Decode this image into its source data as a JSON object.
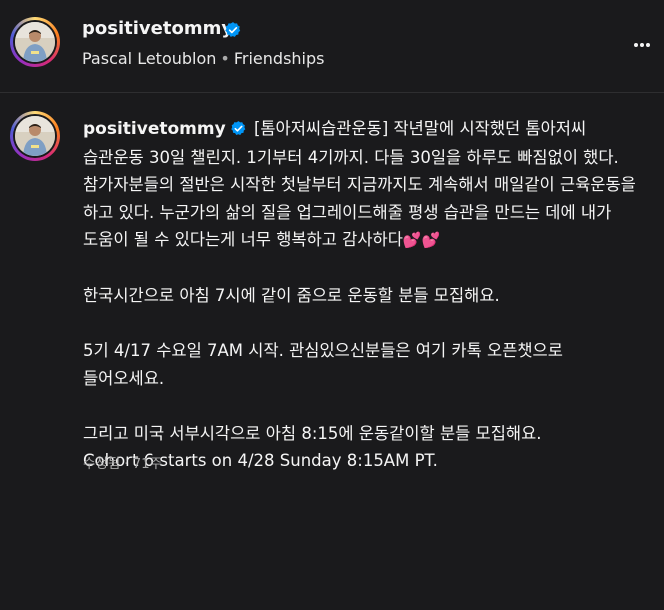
{
  "header": {
    "username": "positivetommy",
    "author_name": "Pascal Letoublon",
    "separator": "•",
    "audio_label": "Friendships"
  },
  "post": {
    "username": "positivetommy",
    "caption_line1": "[톰아저씨습관운동] 작년말에 시작했던 톰아저씨 습관운동 30일 챌린지. 1기부터 4기까지. 다들 30일을 하루도 빠짐없이 했다. 참가자분들의 절반은 시작한 첫날부터 지금까지도 계속해서 매일같이 근육운동을 하고 있다. 누군가의 삶의 질을 업그레이드해줄 평생 습관을 만드는 데에 내가 도움이 될 수 있다는게 너무 행복하고 감사하다",
    "hearts": "💕💕",
    "paragraph2": "한국시간으로 아침 7시에 같이 줌으로 운동할 분들 모집해요.",
    "paragraph3": "5기 4/17 수요일 7AM 시작. 관심있으신분들은 여기 카톡 오픈챗으로 들어오세요.",
    "paragraph4_line1": "그리고 미국 서부시각으로 아침 8:15에 운동같이할 분들 모집해요.",
    "paragraph4_line2": "Cohort 6 starts on 4/28 Sunday 8:15AM PT.",
    "edited_label": "수정됨",
    "meta_separator": "·",
    "age": "71주"
  },
  "icons": {
    "verified": "verified-badge-icon",
    "more": "more-options-icon"
  },
  "colors": {
    "background": "#1a1a1c",
    "verified_blue": "#0095f6",
    "text": "#f5f5f5",
    "secondary_text": "#a8a8a8",
    "heart_pink": "#ff4f9a"
  }
}
